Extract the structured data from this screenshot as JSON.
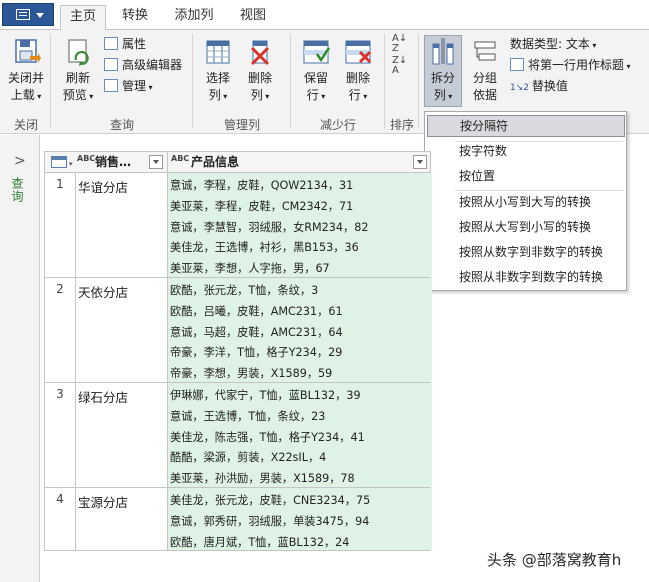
{
  "tabs": [
    "主页",
    "转换",
    "添加列",
    "视图"
  ],
  "ribbon": {
    "close_load": [
      "关闭并",
      "上载"
    ],
    "refresh_preview": [
      "刷新",
      "预览"
    ],
    "properties": "属性",
    "advanced_editor": "高级编辑器",
    "manage": "管理",
    "choose_columns": [
      "选择",
      "列"
    ],
    "remove_columns": [
      "删除",
      "列"
    ],
    "keep_rows": [
      "保留",
      "行"
    ],
    "remove_rows": [
      "删除",
      "行"
    ],
    "split_column": [
      "拆分",
      "列"
    ],
    "group_by": [
      "分组",
      "依据"
    ],
    "data_type": "数据类型: 文本",
    "first_row_header": "将第一行用作标题",
    "replace_values": "替换值",
    "groups": [
      "关闭",
      "查询",
      "管理列",
      "减少行",
      "排序"
    ]
  },
  "dropdown": {
    "items": [
      "按分隔符",
      "按字符数",
      "按位置",
      "按照从小写到大写的转换",
      "按照从大写到小写的转换",
      "按照从数字到非数字的转换",
      "按照从非数字到数字的转换"
    ],
    "highlighted": "按分隔符"
  },
  "query_pane": {
    "label": "查询",
    "arrow": ">"
  },
  "table": {
    "columns": [
      "销售…",
      "产品信息"
    ],
    "column_type": "ABC",
    "rows": [
      {
        "num": "1",
        "store": "华谊分店",
        "lines": [
          "意诚，李程，皮鞋，QOW2134，31",
          "美亚莱，李程，皮鞋，CM2342，71",
          "意诚，李慧智，羽绒服，女RM234，82",
          "美佳龙，王选博，衬衫，黑B153，36",
          "美亚莱，李想，人字拖，男，67"
        ]
      },
      {
        "num": "2",
        "store": "天依分店",
        "lines": [
          "欧酷，张元龙，T恤，条纹，3",
          "欧酷，吕曦，皮鞋，AMC231，61",
          "意诚，马超，皮鞋，AMC231，64",
          "帝豪，李洋，T恤，格子Y234，29",
          "帝豪，李想，男装，X1589，59"
        ]
      },
      {
        "num": "3",
        "store": "绿石分店",
        "lines": [
          "伊琳娜，代家宁，T恤，蓝BL132，39",
          "意诚，王选博，T恤，条纹，23",
          "美佳龙，陈志强，T恤，格子Y234，41",
          "酷酷，梁源，剪装，X22sIL，4",
          "美亚莱，孙洪励，男装，X1589，78"
        ]
      },
      {
        "num": "4",
        "store": "宝源分店",
        "lines": [
          "美佳龙，张元龙，皮鞋，CNE3234，75",
          "意诚，郭秀研，羽绒服，单装3475，94",
          "欧酷，唐月斌，T恤，蓝BL132，24"
        ]
      }
    ]
  },
  "watermark": "头条 @部落窝教育h"
}
